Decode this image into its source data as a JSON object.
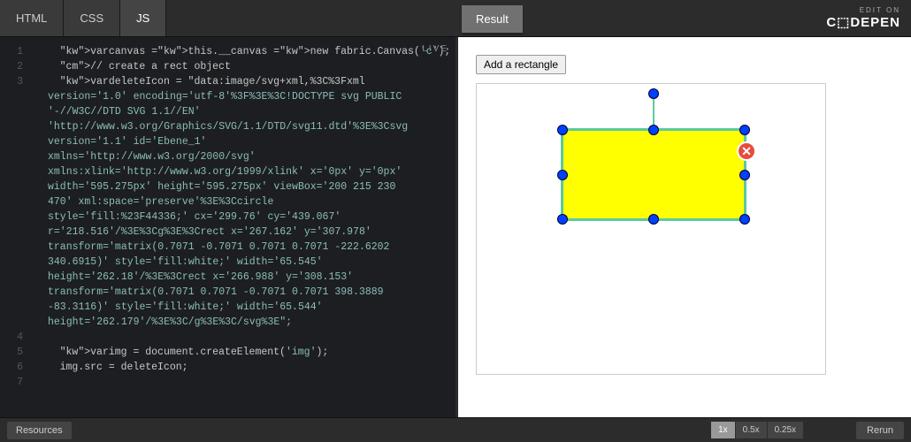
{
  "header": {
    "tabs": [
      "HTML",
      "CSS",
      "JS"
    ],
    "active_tab": 2,
    "result_label": "Result",
    "editon_small": "EDIT ON",
    "editon_logo": "C⬚DEPEN",
    "live_label": "LIVE"
  },
  "code": {
    "lines": [
      {
        "n": "1",
        "t": "    var canvas = this.__canvas = new fabric.Canvas('c');"
      },
      {
        "n": "2",
        "t": "    // create a rect object"
      },
      {
        "n": "3",
        "t": "    var deleteIcon = \"data:image/svg+xml,%3C%3Fxml"
      },
      {
        "w": "version='1.0' encoding='utf-8'%3F%3E%3C!DOCTYPE svg PUBLIC"
      },
      {
        "w": "'-//W3C//DTD SVG 1.1//EN'"
      },
      {
        "w": "'http://www.w3.org/Graphics/SVG/1.1/DTD/svg11.dtd'%3E%3Csvg"
      },
      {
        "w": "version='1.1' id='Ebene_1'"
      },
      {
        "w": "xmlns='http://www.w3.org/2000/svg'"
      },
      {
        "w": "xmlns:xlink='http://www.w3.org/1999/xlink' x='0px' y='0px'"
      },
      {
        "w": "width='595.275px' height='595.275px' viewBox='200 215 230"
      },
      {
        "w": "470' xml:space='preserve'%3E%3Ccircle"
      },
      {
        "w": "style='fill:%23F44336;' cx='299.76' cy='439.067'"
      },
      {
        "w": "r='218.516'/%3E%3Cg%3E%3Crect x='267.162' y='307.978'"
      },
      {
        "w": "transform='matrix(0.7071 -0.7071 0.7071 0.7071 -222.6202"
      },
      {
        "w": "340.6915)' style='fill:white;' width='65.545'"
      },
      {
        "w": "height='262.18'/%3E%3Crect x='266.988' y='308.153'"
      },
      {
        "w": "transform='matrix(0.7071 0.7071 -0.7071 0.7071 398.3889"
      },
      {
        "w": "-83.3116)' style='fill:white;' width='65.544'"
      },
      {
        "w": "height='262.179'/%3E%3C/g%3E%3C/svg%3E\";"
      },
      {
        "n": "4",
        "t": ""
      },
      {
        "n": "5",
        "t": "    var img = document.createElement('img');"
      },
      {
        "n": "6",
        "t": "    img.src = deleteIcon;"
      },
      {
        "n": "7",
        "t": ""
      }
    ]
  },
  "result": {
    "add_button": "Add a rectangle",
    "close_glyph": "✕"
  },
  "footer": {
    "resources": "Resources",
    "zoom": [
      "1x",
      "0.5x",
      "0.25x"
    ],
    "zoom_active": 0,
    "rerun": "Rerun"
  }
}
